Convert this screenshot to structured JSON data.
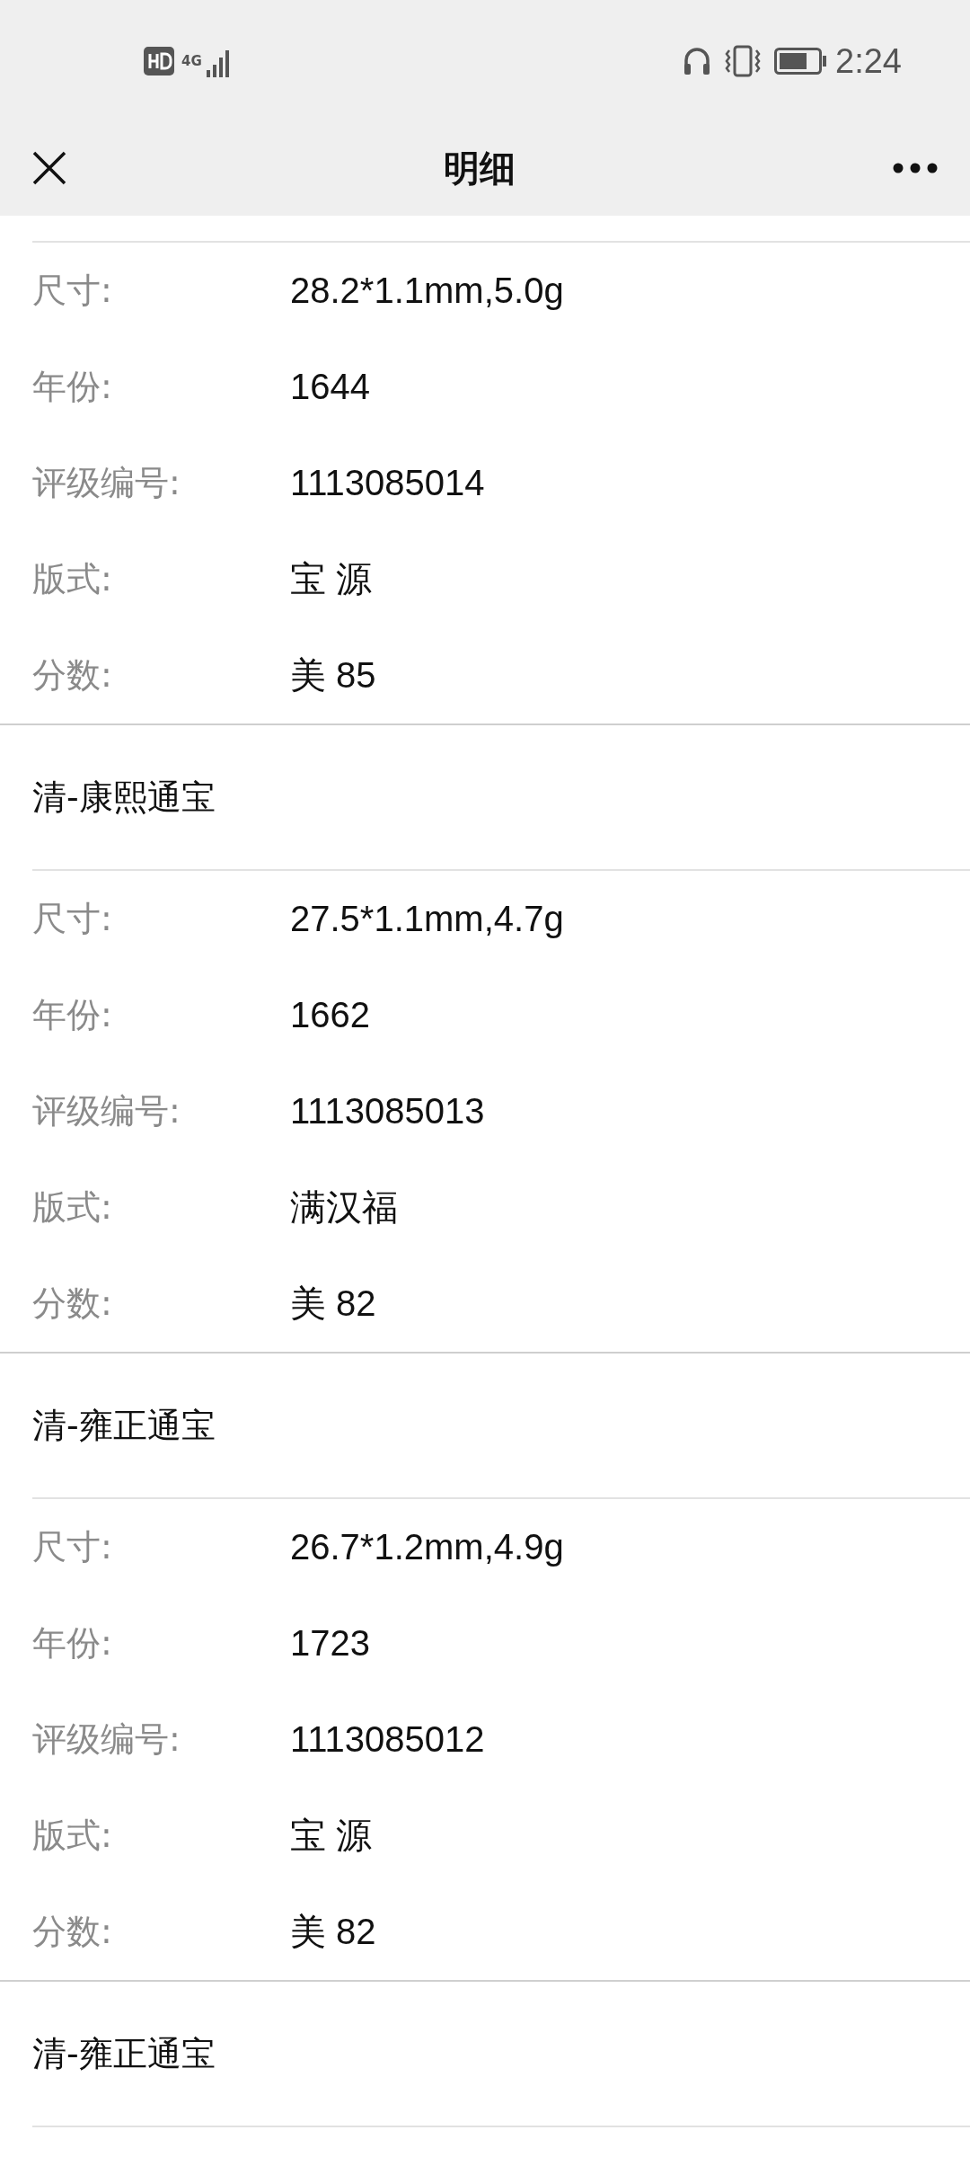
{
  "status_bar": {
    "network": "4G",
    "time": "2:24"
  },
  "nav": {
    "title": "明细"
  },
  "groups": [
    {
      "rows": [
        {
          "label": "尺寸:",
          "value": "28.2*1.1mm,5.0g"
        },
        {
          "label": "年份:",
          "value": "1644"
        },
        {
          "label": "评级编号:",
          "value": "1113085014"
        },
        {
          "label": "版式:",
          "value": "宝 源"
        },
        {
          "label": "分数:",
          "value": "美 85"
        }
      ]
    },
    {
      "title": "清-康熙通宝",
      "rows": [
        {
          "label": "尺寸:",
          "value": "27.5*1.1mm,4.7g"
        },
        {
          "label": "年份:",
          "value": "1662"
        },
        {
          "label": "评级编号:",
          "value": "1113085013"
        },
        {
          "label": "版式:",
          "value": "满汉福"
        },
        {
          "label": "分数:",
          "value": "美 82"
        }
      ]
    },
    {
      "title": "清-雍正通宝",
      "rows": [
        {
          "label": "尺寸:",
          "value": "26.7*1.2mm,4.9g"
        },
        {
          "label": "年份:",
          "value": "1723"
        },
        {
          "label": "评级编号:",
          "value": "1113085012"
        },
        {
          "label": "版式:",
          "value": "宝 源"
        },
        {
          "label": "分数:",
          "value": "美 82"
        }
      ]
    },
    {
      "title": "清-雍正通宝"
    }
  ]
}
